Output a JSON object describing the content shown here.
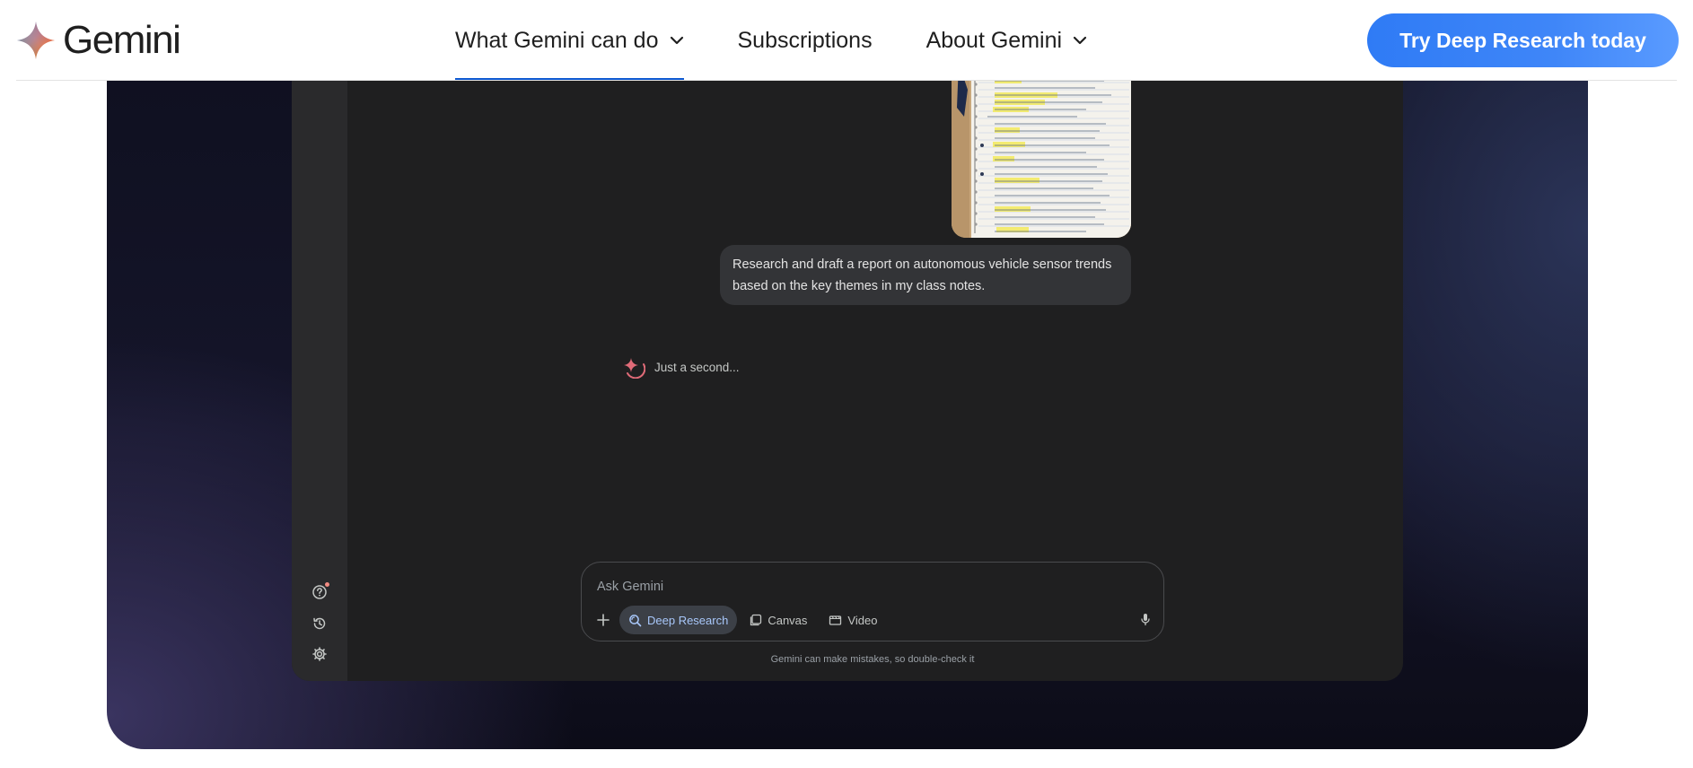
{
  "brand": {
    "name": "Gemini"
  },
  "nav": {
    "items": [
      {
        "label": "What Gemini can do",
        "has_dropdown": true,
        "active": true
      },
      {
        "label": "Subscriptions",
        "has_dropdown": false,
        "active": false
      },
      {
        "label": "About Gemini",
        "has_dropdown": true,
        "active": false
      }
    ],
    "cta_label": "Try Deep Research today"
  },
  "app": {
    "user_message": "Research and draft a report on autonomous vehicle sensor trends based on the key themes in my class notes.",
    "status_text": "Just a second...",
    "composer": {
      "placeholder": "Ask Gemini",
      "tools": [
        {
          "label": "Deep Research",
          "icon": "deep-research-icon",
          "active": true
        },
        {
          "label": "Canvas",
          "icon": "canvas-icon",
          "active": false
        },
        {
          "label": "Video",
          "icon": "video-icon",
          "active": false
        }
      ]
    },
    "disclaimer": "Gemini can make mistakes, so double-check it",
    "rail_icons": [
      "help-icon",
      "history-icon",
      "settings-icon"
    ]
  },
  "colors": {
    "accent": "#0b57d0",
    "cta": "#3f86f8",
    "app_bg": "#1f1f20",
    "chip_active_text": "#a8c7fa"
  }
}
